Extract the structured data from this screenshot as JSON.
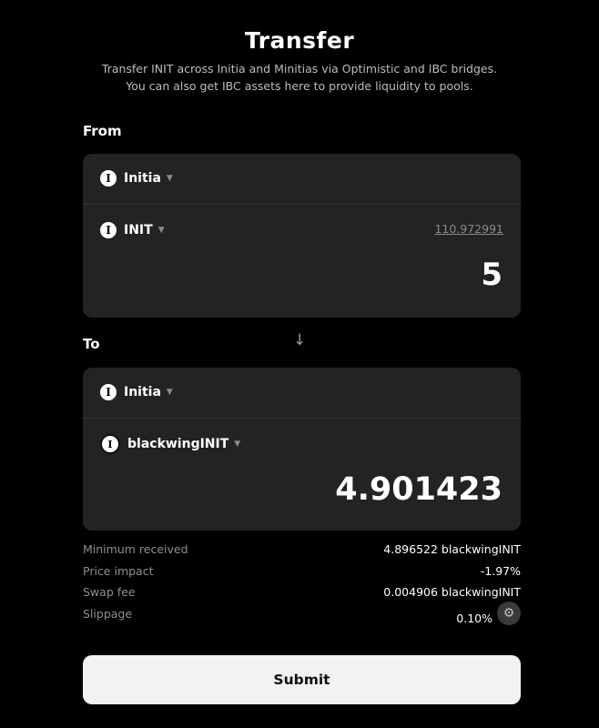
{
  "header": {
    "title": "Transfer",
    "subtitle_line1": "Transfer INIT across Initia and Minitias via Optimistic and IBC bridges.",
    "subtitle_line2": "You can also get IBC assets here to provide liquidity to pools."
  },
  "from": {
    "label": "From",
    "chain": {
      "name": "Initia",
      "icon": "initia-logo-icon"
    },
    "token": {
      "symbol": "INIT",
      "icon": "initia-logo-icon"
    },
    "balance": "110.972991",
    "amount": "5"
  },
  "to": {
    "label": "To",
    "chain": {
      "name": "Initia",
      "icon": "initia-logo-icon"
    },
    "token": {
      "symbol": "blackwingINIT",
      "icon": "blackwing-logo-icon"
    },
    "amount": "4.901423"
  },
  "details": {
    "min_received_label": "Minimum received",
    "min_received_value": "4.896522 blackwingINIT",
    "price_impact_label": "Price impact",
    "price_impact_value": "-1.97%",
    "swap_fee_label": "Swap fee",
    "swap_fee_value": "0.004906 blackwingINIT",
    "slippage_label": "Slippage",
    "slippage_value": "0.10%"
  },
  "submit_label": "Submit",
  "colors": {
    "background": "#000000",
    "card": "#232323",
    "button": "#f2f2f2"
  }
}
